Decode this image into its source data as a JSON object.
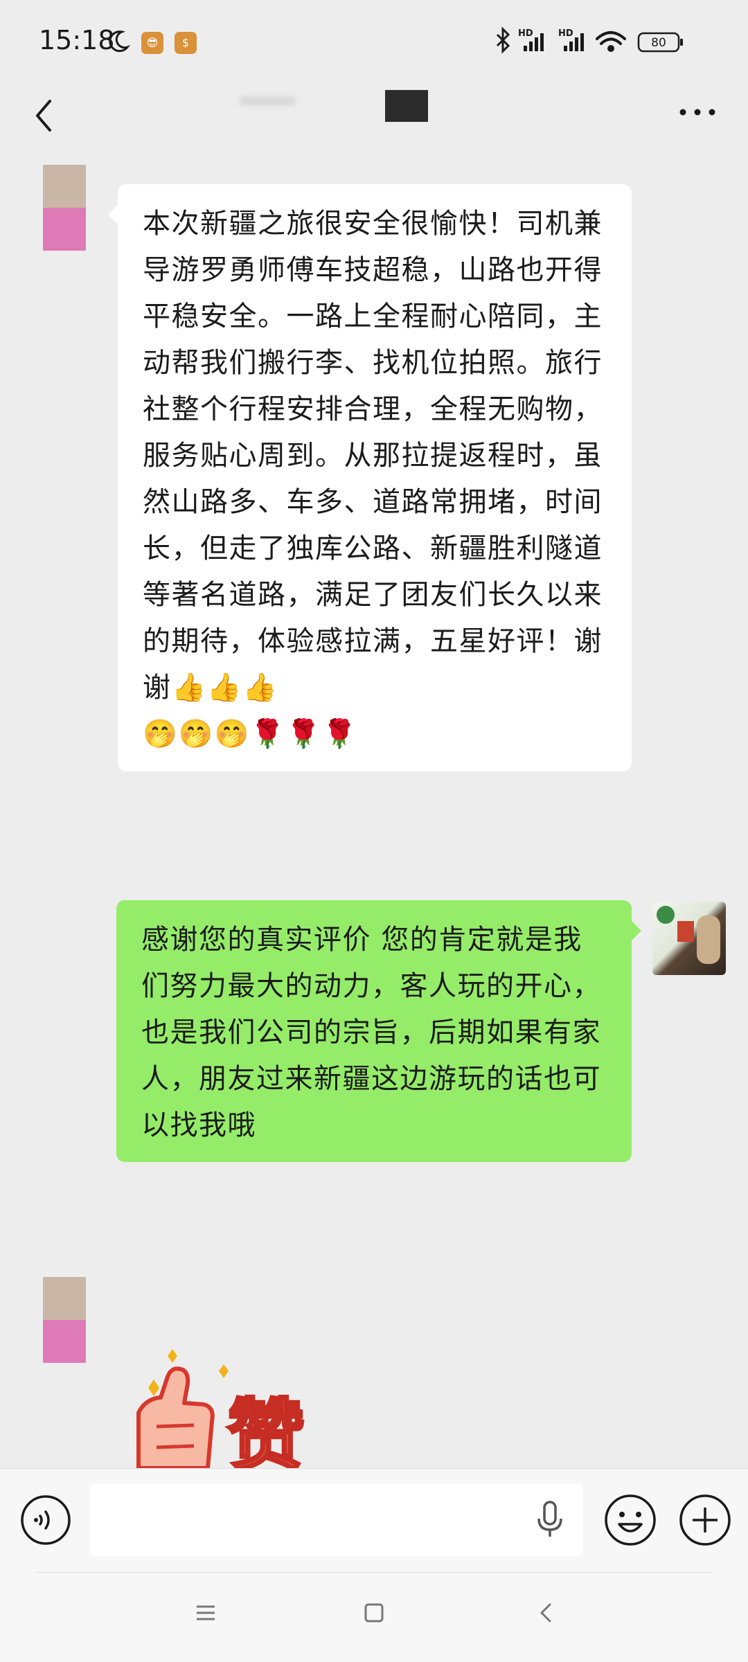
{
  "status_bar": {
    "time": "15:18",
    "signal_labels": [
      "HD",
      "HD"
    ],
    "battery": "80"
  },
  "chat_header": {
    "title": ""
  },
  "messages": [
    {
      "side": "left",
      "text": "本次新疆之旅很安全很愉快！司机兼导游罗勇师傅车技超稳，山路也开得平稳安全。一路上全程耐心陪同，主动帮我们搬行李、找机位拍照。旅行社整个行程安排合理，全程无购物，服务贴心周到。从那拉提返程时，虽然山路多、车多、道路常拥堵，时间长，但走了独库公路、新疆胜利隧道等著名道路，满足了团友们长久以来的期待，体验感拉满，五星好评！谢谢👍👍👍",
      "emoji_line": "🤭🤭🤭🌹🌹🌹"
    },
    {
      "side": "right",
      "text": "感谢您的真实评价  您的肯定就是我们努力最大的动力，客人玩的开心，也是我们公司的宗旨，后期如果有家人，朋友过来新疆这边游玩的话也可以找我哦"
    },
    {
      "side": "left",
      "sticker": "赞"
    }
  ],
  "input_bar": {
    "value": "",
    "placeholder": ""
  },
  "icons": {
    "back": "chevron-left-icon",
    "more": "more-dots-icon",
    "voice": "voice-toggle-icon",
    "mic": "microphone-icon",
    "emoji": "emoji-icon",
    "plus": "plus-icon"
  }
}
